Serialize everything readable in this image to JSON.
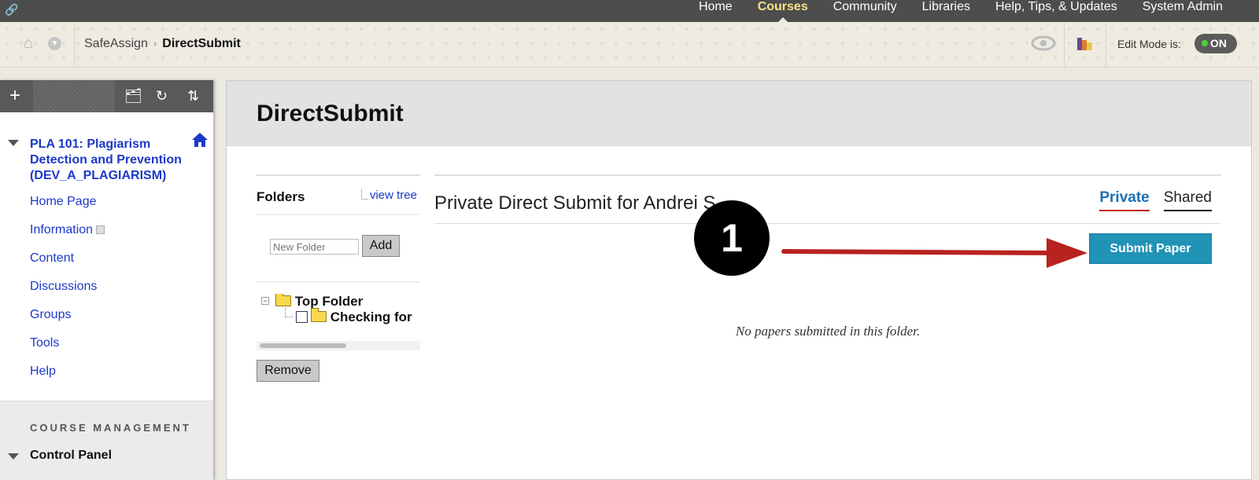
{
  "topnav": {
    "tabs": [
      {
        "label": "Home",
        "active": false
      },
      {
        "label": "Courses",
        "active": true
      },
      {
        "label": "Community",
        "active": false
      },
      {
        "label": "Libraries",
        "active": false
      },
      {
        "label": "Help, Tips, & Updates",
        "active": false
      },
      {
        "label": "System Admin",
        "active": false
      }
    ]
  },
  "breadcrumb": {
    "items": [
      "SafeAssign",
      "DirectSubmit"
    ],
    "edit_mode_label": "Edit Mode is:",
    "edit_mode_value": "ON"
  },
  "sidebar": {
    "course_title": "PLA 101: Plagiarism Detection and Prevention (DEV_A_PLAGIARISM)",
    "items": [
      {
        "label": "Home Page"
      },
      {
        "label": "Information"
      },
      {
        "label": "Content"
      },
      {
        "label": "Discussions"
      },
      {
        "label": "Groups"
      },
      {
        "label": "Tools"
      },
      {
        "label": "Help"
      }
    ],
    "management_header": "COURSE MANAGEMENT",
    "control_panel": "Control Panel"
  },
  "main": {
    "title": "DirectSubmit",
    "folders": {
      "heading": "Folders",
      "view_tree": "view tree",
      "new_folder_placeholder": "New Folder",
      "add_label": "Add",
      "top_folder": "Top Folder",
      "sub_folder": "Checking for",
      "remove_label": "Remove"
    },
    "panel": {
      "title": "Private Direct Submit for Andrei S",
      "tabs": [
        {
          "label": "Private",
          "active": true
        },
        {
          "label": "Shared",
          "active": false
        }
      ],
      "submit_label": "Submit Paper",
      "empty_message": "No papers submitted in this folder."
    }
  },
  "annotation": {
    "step_number": "1",
    "arrow_color": "#b8231f"
  },
  "colors": {
    "link": "#1b39c8",
    "submit_button": "#2193b6",
    "nav_active": "#f7e08a"
  }
}
